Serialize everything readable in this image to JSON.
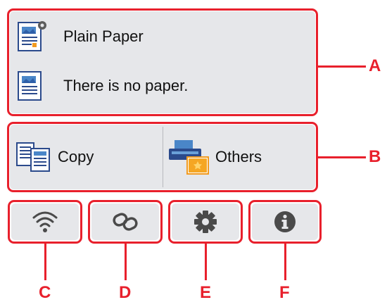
{
  "paper_info": {
    "paper_type": "Plain Paper",
    "paper_status": "There is no paper."
  },
  "menu": {
    "copy_label": "Copy",
    "others_label": "Others"
  },
  "bottom_buttons": {
    "wifi_icon": "wifi-icon",
    "link_icon": "link-icon",
    "settings_icon": "gear-icon",
    "info_icon": "info-icon"
  },
  "callouts": {
    "a": "A",
    "b": "B",
    "c": "C",
    "d": "D",
    "e": "E",
    "f": "F"
  },
  "colors": {
    "callout_red": "#e8202c",
    "panel_gray": "#e6e7ea",
    "icon_gray": "#4a4a4a"
  }
}
